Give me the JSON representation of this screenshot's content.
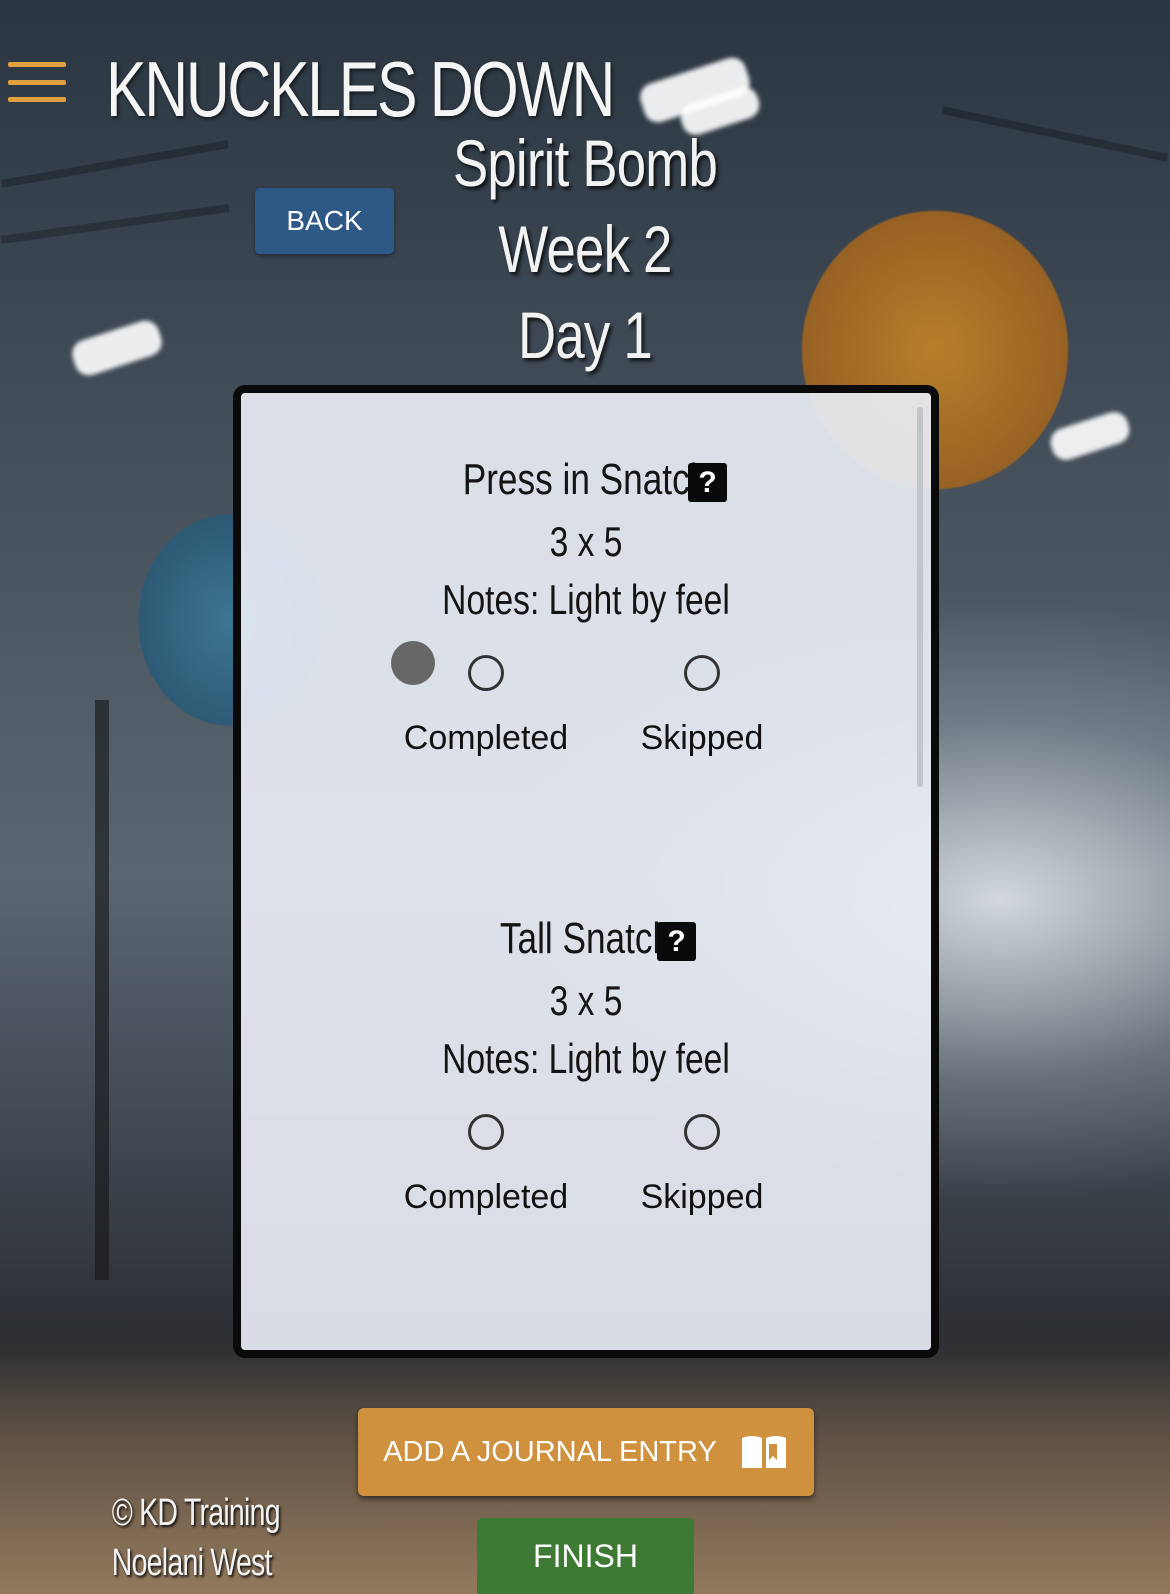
{
  "header": {
    "brand": "KNUCKLES DOWN",
    "program": "Spirit Bomb",
    "week": "Week 2",
    "day": "Day 1",
    "back_label": "BACK"
  },
  "exercises": [
    {
      "name": "Press in Snatch",
      "help": "?",
      "scheme": "3 x 5",
      "notes": "Notes: Light by feel",
      "options": {
        "completed": "Completed",
        "skipped": "Skipped"
      }
    },
    {
      "name": "Tall Snatch",
      "help": "?",
      "scheme": "3 x 5",
      "notes": "Notes: Light by feel",
      "options": {
        "completed": "Completed",
        "skipped": "Skipped"
      }
    }
  ],
  "actions": {
    "journal_label": "ADD A JOURNAL ENTRY",
    "journal_icon": "book-icon",
    "finish_label": "FINISH"
  },
  "footer": {
    "copyright": "© KD Training",
    "athlete": "Noelani West"
  },
  "colors": {
    "menu": "#e0a040",
    "back": "#2e5886",
    "journal": "#cf913e",
    "finish": "#3f7a35"
  }
}
